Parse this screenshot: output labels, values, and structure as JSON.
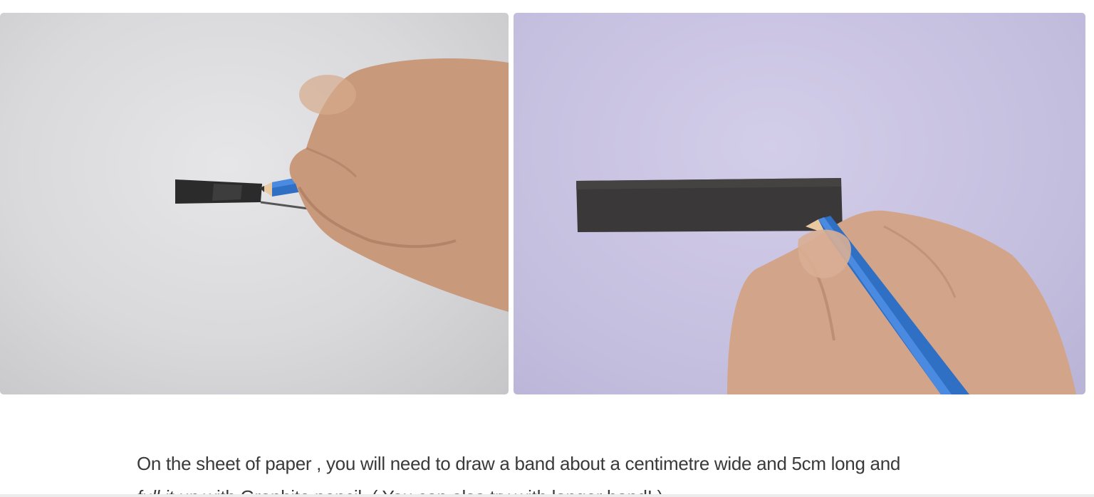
{
  "photos": [
    {
      "subject": "hand-drawing-band-with-pencil"
    },
    {
      "subject": "hand-filling-band-with-graphite"
    }
  ],
  "caption": {
    "part1": "On the sheet of paper , you will need to draw a band about a centimetre wide and 5cm long and",
    "emphasis": "full it up",
    "part2": " with Graphite pencil. ( You can also try with longer band! )."
  },
  "colors": {
    "text": "#3a3a3a",
    "pencil": "#2f6fc4",
    "graphite": "#2b2b2b"
  }
}
